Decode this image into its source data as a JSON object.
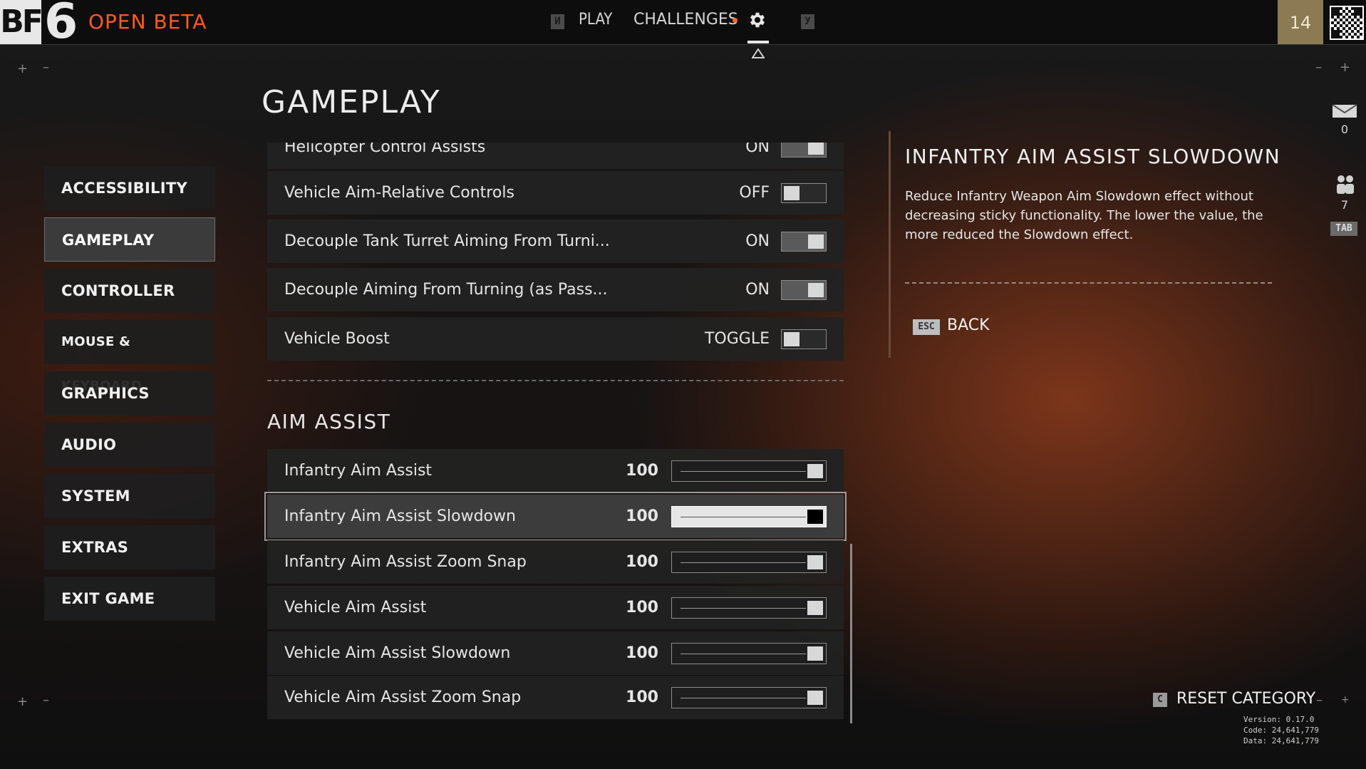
{
  "header": {
    "logo_text": "BF",
    "logo_number": "6",
    "edition": "OPEN BETA",
    "nav_prev_key": "И",
    "nav_next_key": "У",
    "nav": [
      "PLAY",
      "CHALLENGES"
    ],
    "active_tab_icon": "gear-icon",
    "player_level": "14"
  },
  "page": {
    "title": "GAMEPLAY"
  },
  "sidebar": {
    "items": [
      {
        "label": "ACCESSIBILITY"
      },
      {
        "label": "GAMEPLAY"
      },
      {
        "label": "CONTROLLER"
      },
      {
        "label": "MOUSE & KEYBOARD"
      },
      {
        "label": "GRAPHICS"
      },
      {
        "label": "AUDIO"
      },
      {
        "label": "SYSTEM"
      },
      {
        "label": "EXTRAS"
      },
      {
        "label": "EXIT GAME"
      }
    ]
  },
  "vehicle_settings": [
    {
      "label": "Helicopter Control Assists",
      "value": "ON"
    },
    {
      "label": "Vehicle Aim-Relative Controls",
      "value": "OFF"
    },
    {
      "label": "Decouple Tank Turret Aiming From Turni...",
      "value": "ON"
    },
    {
      "label": "Decouple Aiming From Turning (as Pass...",
      "value": "ON"
    },
    {
      "label": "Vehicle Boost",
      "value": "TOGGLE"
    }
  ],
  "aim_assist": {
    "heading": "AIM ASSIST",
    "rows": [
      {
        "label": "Infantry Aim Assist",
        "value": "100",
        "level": 1.0
      },
      {
        "label": "Infantry Aim Assist Slowdown",
        "value": "100",
        "level": 1.0
      },
      {
        "label": "Infantry Aim Assist Zoom Snap",
        "value": "100",
        "level": 1.0
      },
      {
        "label": "Vehicle Aim Assist",
        "value": "100",
        "level": 1.0
      },
      {
        "label": "Vehicle Aim Assist Slowdown",
        "value": "100",
        "level": 1.0
      },
      {
        "label": "Vehicle Aim Assist Zoom Snap",
        "value": "100",
        "level": 1.0
      }
    ]
  },
  "info_panel": {
    "title": "INFANTRY AIM ASSIST SLOWDOWN",
    "description": "Reduce Infantry Weapon Aim Slowdown effect without decreasing sticky functionality. The lower the value, the more reduced the Slowdown effect.",
    "back_key": "ESC",
    "back_label": "BACK"
  },
  "side_counters": {
    "messages": "0",
    "squad": "7",
    "tab_key": "TAB"
  },
  "footer": {
    "reset_key": "C",
    "reset_label": "RESET CATEGORY",
    "version": "Version: 0.17.0",
    "code": "Code: 24,641,779",
    "data": "Data: 24,641,779"
  },
  "colors": {
    "accent": "#ff5a1f",
    "level_badge": "#8b7a52"
  }
}
